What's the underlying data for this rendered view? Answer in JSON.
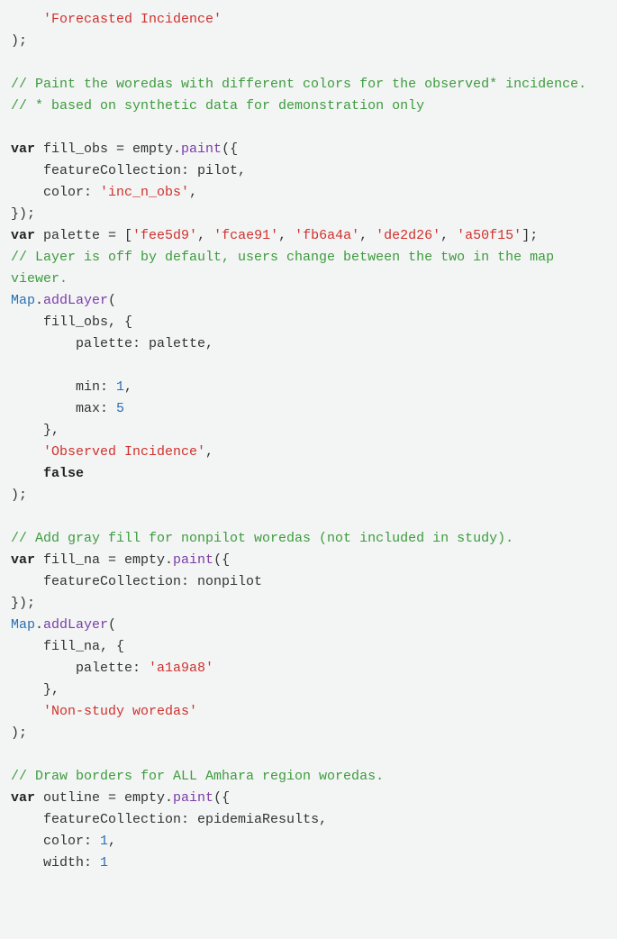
{
  "code": {
    "l1_str": "'Forecasted Incidence'",
    "l2": ");",
    "l3_com": "// Paint the woredas with different colors for the observed* incidence.",
    "l4_com": "// * based on synthetic data for demonstration only",
    "l5_kw": "var",
    "l5_txt1": " fill_obs = empty.",
    "l5_fn": "paint",
    "l5_txt2": "({",
    "l6": "    featureCollection: pilot,",
    "l7_txt1": "    color: ",
    "l7_str": "'inc_n_obs'",
    "l7_txt2": ",",
    "l8": "});",
    "l9_kw": "var",
    "l9_txt1": " palette = [",
    "l9_s1": "'fee5d9'",
    "l9_c": ", ",
    "l9_s2": "'fcae91'",
    "l9_s3": "'fb6a4a'",
    "l9_s4": "'de2d26'",
    "l9_s5": "'a50f15'",
    "l9_txt2": "];",
    "l10_com": "// Layer is off by default, users change between the two in the map viewer.",
    "l11_obj": "Map",
    "l11_txt1": ".",
    "l11_fn": "addLayer",
    "l11_txt2": "(",
    "l12": "    fill_obs, {",
    "l13": "        palette: palette,",
    "l14_txt": "        min: ",
    "l14_num": "1",
    "l14_c": ",",
    "l15_txt": "        max: ",
    "l15_num": "5",
    "l16": "    },",
    "l17_str": "'Observed Incidence'",
    "l17_c": ",",
    "l18_bool": "false",
    "l19": ");",
    "l20_com": "// Add gray fill for nonpilot woredas (not included in study).",
    "l21_kw": "var",
    "l21_txt1": " fill_na = empty.",
    "l21_fn": "paint",
    "l21_txt2": "({",
    "l22": "    featureCollection: nonpilot",
    "l23": "});",
    "l24_obj": "Map",
    "l24_txt1": ".",
    "l24_fn": "addLayer",
    "l24_txt2": "(",
    "l25": "    fill_na, {",
    "l26_txt": "        palette: ",
    "l26_str": "'a1a9a8'",
    "l27": "    },",
    "l28_str": "'Non-study woredas'",
    "l29": ");",
    "l30_com": "// Draw borders for ALL Amhara region woredas.",
    "l31_kw": "var",
    "l31_txt1": " outline = empty.",
    "l31_fn": "paint",
    "l31_txt2": "({",
    "l32": "    featureCollection: epidemiaResults,",
    "l33_txt": "    color: ",
    "l33_num": "1",
    "l33_c": ",",
    "l34_txt": "    width: ",
    "l34_num": "1"
  }
}
